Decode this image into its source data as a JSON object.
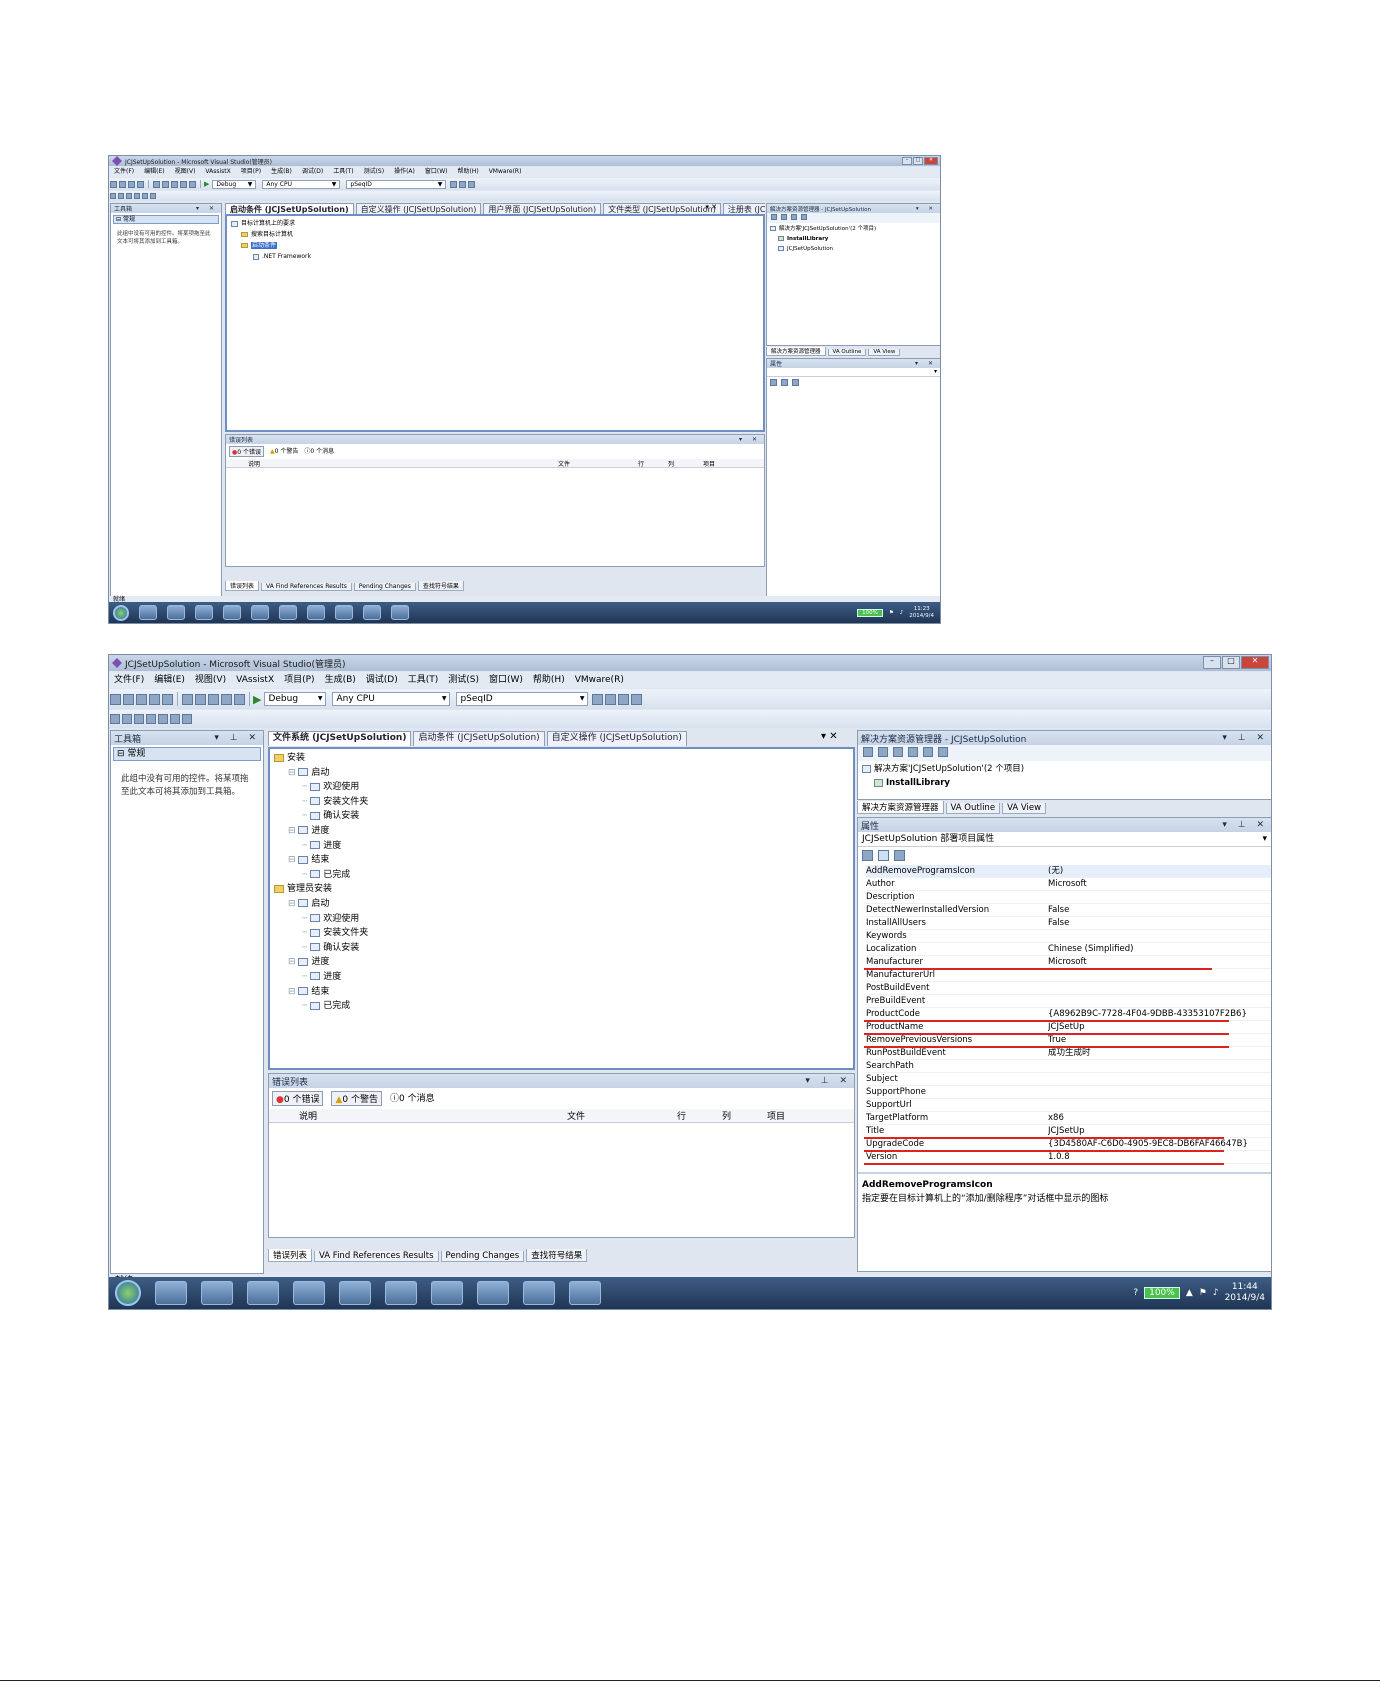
{
  "shot1": {
    "window_title": "JCJSetUpSolution - Microsoft Visual Studio(管理员)",
    "menu": [
      "文件(F)",
      "编辑(E)",
      "视图(V)",
      "VAssistX",
      "项目(P)",
      "生成(B)",
      "调试(D)",
      "工具(T)",
      "测试(S)",
      "操作(A)",
      "窗口(W)",
      "帮助(H)",
      "VMware(R)"
    ],
    "toolbar": {
      "config": "Debug",
      "platform": "Any CPU",
      "find": "pSeqID"
    },
    "toolbox": {
      "title": "工具箱",
      "group": "常规",
      "empty_text": "此组中没有可用的控件。将某项拖至此文本可将其添加到工具箱。"
    },
    "doc_tabs": [
      "启动条件 (JCJSetUpSolution)",
      "自定义操作 (JCJSetUpSolution)",
      "用户界面 (JCJSetUpSolution)",
      "文件类型 (JCJSetUpSolution)",
      "注册表 (JCJSetUpSolution)"
    ],
    "launch_tree": [
      "目标计算机上的要求",
      "搜索目标计算机",
      "启动条件",
      ".NET Framework"
    ],
    "error_list": {
      "title": "错误列表",
      "errors": "0 个错误",
      "warnings": "0 个警告",
      "messages": "0 个消息",
      "cols": [
        "说明",
        "文件",
        "行",
        "列",
        "项目"
      ]
    },
    "bottom_tabs": [
      "错误列表",
      "VA Find References Results",
      "Pending Changes",
      "查找符号结果"
    ],
    "solution_explorer": {
      "title": "解决方案资源管理器 - JCJSetUpSolution",
      "solution": "解决方案'JCJSetUpSolution'(2 个项目)",
      "projects": [
        "InstallLibrary",
        "JCJSetUpSolution"
      ]
    },
    "se_tabs": [
      "解决方案资源管理器",
      "VA Outline",
      "VA View"
    ],
    "props_title": "属性",
    "status": "就绪",
    "clock": {
      "time": "11:23",
      "date": "2014/9/4"
    },
    "battery": "100%"
  },
  "shot2": {
    "window_title": "JCJSetUpSolution - Microsoft Visual Studio(管理员)",
    "menu": [
      "文件(F)",
      "编辑(E)",
      "视图(V)",
      "VAssistX",
      "项目(P)",
      "生成(B)",
      "调试(D)",
      "工具(T)",
      "测试(S)",
      "窗口(W)",
      "帮助(H)",
      "VMware(R)"
    ],
    "toolbar": {
      "config": "Debug",
      "platform": "Any CPU",
      "find": "pSeqID"
    },
    "toolbox": {
      "title": "工具箱",
      "group": "常规",
      "empty_text": "此组中没有可用的控件。将某项拖至此文本可将其添加到工具箱。"
    },
    "doc_tabs": [
      "文件系统 (JCJSetUpSolution)",
      "启动条件 (JCJSetUpSolution)",
      "自定义操作 (JCJSetUpSolution)"
    ],
    "ui_tree": [
      {
        "t": "安装",
        "lvl": 0,
        "kind": "root"
      },
      {
        "t": "启动",
        "lvl": 1,
        "kind": "group"
      },
      {
        "t": "欢迎使用",
        "lvl": 2,
        "kind": "page"
      },
      {
        "t": "安装文件夹",
        "lvl": 2,
        "kind": "page"
      },
      {
        "t": "确认安装",
        "lvl": 2,
        "kind": "page"
      },
      {
        "t": "进度",
        "lvl": 1,
        "kind": "group"
      },
      {
        "t": "进度",
        "lvl": 2,
        "kind": "page"
      },
      {
        "t": "结束",
        "lvl": 1,
        "kind": "group"
      },
      {
        "t": "已完成",
        "lvl": 2,
        "kind": "page"
      },
      {
        "t": "管理员安装",
        "lvl": 0,
        "kind": "root"
      },
      {
        "t": "启动",
        "lvl": 1,
        "kind": "group"
      },
      {
        "t": "欢迎使用",
        "lvl": 2,
        "kind": "page"
      },
      {
        "t": "安装文件夹",
        "lvl": 2,
        "kind": "page"
      },
      {
        "t": "确认安装",
        "lvl": 2,
        "kind": "page"
      },
      {
        "t": "进度",
        "lvl": 1,
        "kind": "group"
      },
      {
        "t": "进度",
        "lvl": 2,
        "kind": "page"
      },
      {
        "t": "结束",
        "lvl": 1,
        "kind": "group"
      },
      {
        "t": "已完成",
        "lvl": 2,
        "kind": "page"
      }
    ],
    "error_list": {
      "title": "错误列表",
      "errors": "0 个错误",
      "warnings": "0 个警告",
      "messages": "0 个消息",
      "cols": [
        "说明",
        "文件",
        "行",
        "列",
        "项目"
      ]
    },
    "bottom_tabs": [
      "错误列表",
      "VA Find References Results",
      "Pending Changes",
      "查找符号结果"
    ],
    "solution_explorer": {
      "title": "解决方案资源管理器 - JCJSetUpSolution",
      "solution": "解决方案'JCJSetUpSolution'(2 个项目)",
      "project": "InstallLibrary"
    },
    "se_tabs": [
      "解决方案资源管理器",
      "VA Outline",
      "VA View"
    ],
    "props": {
      "title": "属性",
      "object": "JCJSetUpSolution 部署项目属性",
      "rows": [
        [
          "AddRemoveProgramsIcon",
          "(无)"
        ],
        [
          "Author",
          "Microsoft"
        ],
        [
          "Description",
          ""
        ],
        [
          "DetectNewerInstalledVersion",
          "False"
        ],
        [
          "InstallAllUsers",
          "False"
        ],
        [
          "Keywords",
          ""
        ],
        [
          "Localization",
          "Chinese (Simplified)"
        ],
        [
          "Manufacturer",
          "Microsoft"
        ],
        [
          "ManufacturerUrl",
          ""
        ],
        [
          "PostBuildEvent",
          ""
        ],
        [
          "PreBuildEvent",
          ""
        ],
        [
          "ProductCode",
          "{A8962B9C-7728-4F04-9DBB-43353107F2B6}"
        ],
        [
          "ProductName",
          "JCJSetUp"
        ],
        [
          "RemovePreviousVersions",
          "True"
        ],
        [
          "RunPostBuildEvent",
          "成功生成时"
        ],
        [
          "SearchPath",
          ""
        ],
        [
          "Subject",
          ""
        ],
        [
          "SupportPhone",
          ""
        ],
        [
          "SupportUrl",
          ""
        ],
        [
          "TargetPlatform",
          "x86"
        ],
        [
          "Title",
          "JCJSetUp"
        ],
        [
          "UpgradeCode",
          "{3D4580AF-C6D0-4905-9EC8-DB6FAF46647B}"
        ],
        [
          "Version",
          "1.0.8"
        ]
      ],
      "desc_title": "AddRemoveProgramsIcon",
      "desc_text": "指定要在目标计算机上的“添加/删除程序”对话框中显示的图标"
    },
    "status": "就绪",
    "clock": {
      "time": "11:44",
      "date": "2014/9/4"
    },
    "battery": "100%"
  }
}
